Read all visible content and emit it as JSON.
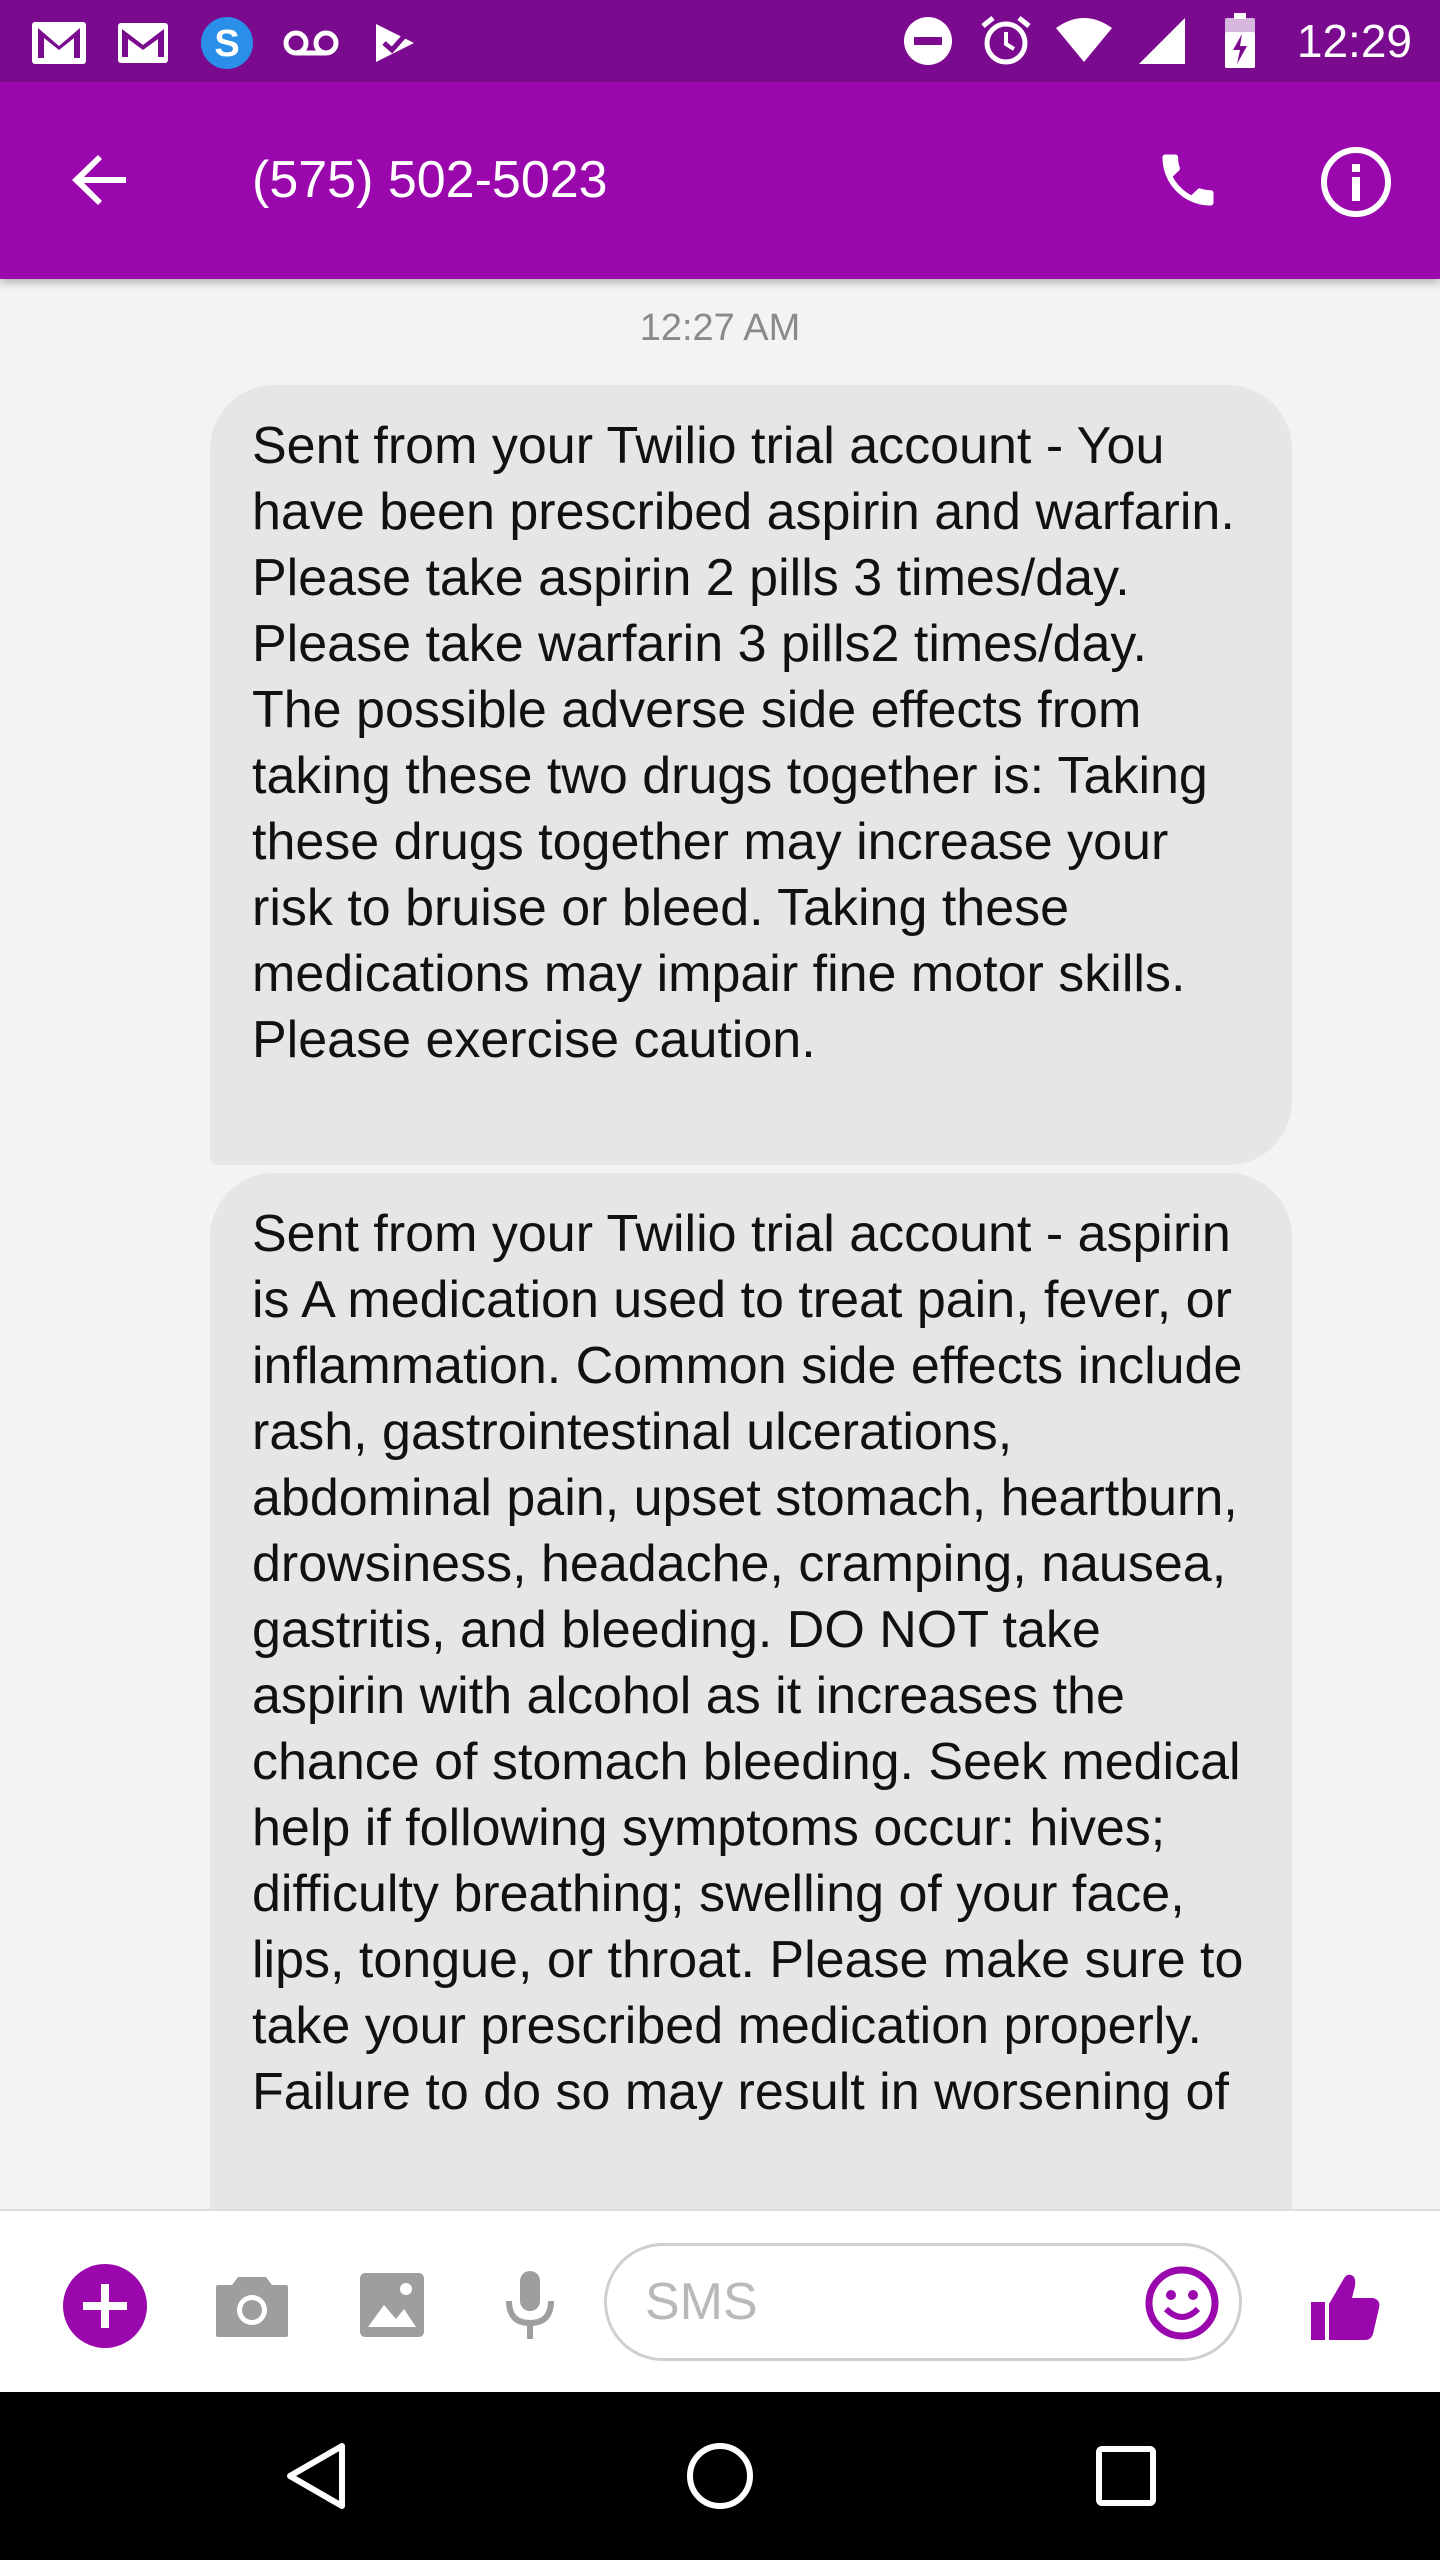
{
  "status_bar": {
    "time": "12:29",
    "left_icons": [
      "gmail-icon",
      "email-icon",
      "swiftkey-icon",
      "voicemail-icon",
      "check-flag-icon"
    ],
    "right_icons": [
      "do-not-disturb-icon",
      "alarm-icon",
      "wifi-icon",
      "signal-icon",
      "battery-charging-icon"
    ]
  },
  "header": {
    "title": "(575) 502-5023",
    "back_icon": "arrow-back-icon",
    "call_icon": "phone-icon",
    "info_icon": "info-icon"
  },
  "conversation": {
    "timestamp": "12:27 AM",
    "messages": [
      {
        "text": "Sent from your Twilio trial account - You have been prescribed aspirin and warfarin. Please take aspirin 2 pills 3 times/day. Please take warfarin 3 pills2 times/day. The possible adverse side effects from taking these two drugs together is: Taking these drugs together may increase your risk to bruise or bleed. Taking these medications may impair fine motor skills. Please exercise caution."
      },
      {
        "text": "Sent from your Twilio trial account - aspirin is A medication used to treat pain, fever, or inflammation. Common side effects include rash, gastrointestinal ulcerations, abdominal pain, upset stomach, heartburn, drowsiness, headache, cramping, nausea, gastritis, and bleeding. DO NOT take aspirin with alcohol as it increases the chance of stomach bleeding. Seek medical help if following symptoms occur:  hives; difficulty breathing; swelling of your face, lips, tongue, or throat. Please make sure to take your prescribed medication properly. Failure to do so may result in worsening of"
      }
    ]
  },
  "compose": {
    "placeholder": "SMS",
    "icons": [
      "add-circle-icon",
      "camera-icon",
      "image-icon",
      "microphone-icon",
      "emoji-icon",
      "thumbs-up-icon"
    ],
    "accent_color": "#9a08ad"
  },
  "nav_bar": {
    "icons": [
      "nav-back-icon",
      "nav-home-icon",
      "nav-recents-icon"
    ]
  },
  "colors": {
    "status_bar": "#7a0a8e",
    "app_bar": "#9a08ad",
    "bubble": "#e6e6e6",
    "background": "#f3f3f3"
  }
}
